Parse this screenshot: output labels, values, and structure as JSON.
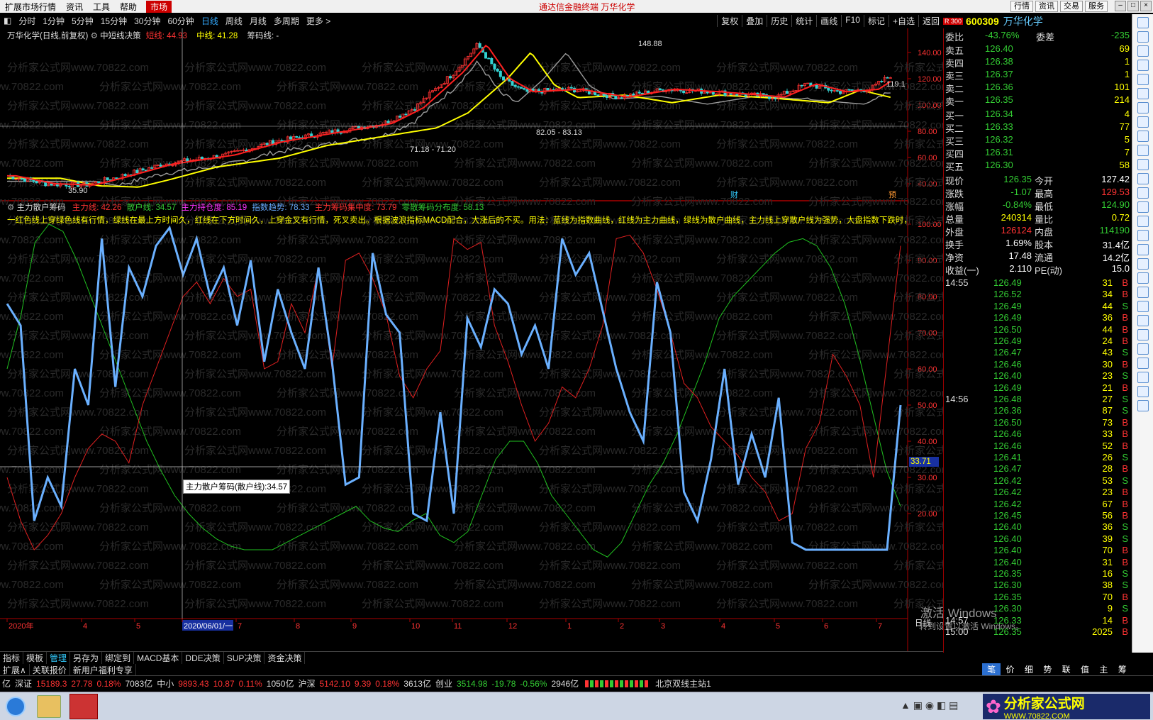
{
  "menu": [
    "扩展市场行情",
    "资讯",
    "工具",
    "帮助"
  ],
  "market_tab": "市场",
  "window_title": "通达信金融终端  万华化学",
  "win_right": [
    "行情",
    "资讯",
    "交易",
    "服务"
  ],
  "periods": [
    "分时",
    "1分钟",
    "5分钟",
    "15分钟",
    "30分钟",
    "60分钟",
    "日线",
    "周线",
    "月线",
    "多周期",
    "更多 >"
  ],
  "active_period": "日线",
  "tool_right": [
    "复权",
    "叠加",
    "历史",
    "统计",
    "画线",
    "F10",
    "标记",
    "+自选",
    "返回"
  ],
  "symbol": {
    "code": "600309",
    "name": "万华化学",
    "badge": "R 300"
  },
  "main_legend": {
    "title": "万华化学(日线,前复权)",
    "ind": "中短线决策",
    "short_label": "短线: 44.93",
    "mid_label": "中线: 41.28",
    "cost_label": "筹码线: -"
  },
  "price_axis": [
    "140.00",
    "120.00",
    "100.00",
    "80.00",
    "60.00",
    "40.00"
  ],
  "price_annot": {
    "high": "148.88",
    "low": "35.90",
    "mid1": "71.18 - 71.20",
    "mid2": "82.05 - 83.13",
    "right": "119.1"
  },
  "event_marks": {
    "cai": "财",
    "duo": "预"
  },
  "sub_legend": {
    "title": "主力散户筹码",
    "a": "主力线: 42.26",
    "b": "散户线: 34.57",
    "c": "主力持仓度: 85.19",
    "d": "指数趋势: 78.33",
    "e": "主力筹码集中度: 73.79",
    "f": "零散筹码分布度: 58.13"
  },
  "scroll_text": "一红色线上穿绿色线有行情，绿线在最上方时间久，红线在下方时间久，上穿金叉有行情，死叉卖出。根据波浪指标MACD配合，大涨后的不买。用法：蓝线为指数曲线，红线为主力曲线，绿线为散户曲线，主力线上穿散户线为强势，大盘指数下跌时，主力线上穿指",
  "sub_axis": [
    "100.00",
    "90.00",
    "80.00",
    "70.00",
    "60.00",
    "50.00",
    "40.00",
    "30.00",
    "20.00"
  ],
  "cross_value": "33.71",
  "tooltip": "主力散户筹码(散户线):34.57",
  "date_axis": [
    {
      "t": "2020年",
      "hl": false
    },
    {
      "t": "4",
      "hl": false
    },
    {
      "t": "5",
      "hl": false
    },
    {
      "t": "2020/06/01/一",
      "hl": true
    },
    {
      "t": "7",
      "hl": false
    },
    {
      "t": "8",
      "hl": false
    },
    {
      "t": "9",
      "hl": false
    },
    {
      "t": "10",
      "hl": false
    },
    {
      "t": "11",
      "hl": false
    },
    {
      "t": "12",
      "hl": false
    },
    {
      "t": "1",
      "hl": false
    },
    {
      "t": "2",
      "hl": false
    },
    {
      "t": "3",
      "hl": false
    },
    {
      "t": "4",
      "hl": false
    },
    {
      "t": "5",
      "hl": false
    },
    {
      "t": "6",
      "hl": false
    },
    {
      "t": "7",
      "hl": false
    }
  ],
  "period_tag": "日线",
  "watermark": "分析家公式网www.70822.com",
  "activate": {
    "l1": "激活 Windows",
    "l2": "转到设置以激活 Windows。"
  },
  "tabs1": [
    "指标",
    "模板",
    "管理",
    "另存为",
    "绑定到",
    "MACD基本",
    "DDE决策",
    "SUP决策",
    "资金决策"
  ],
  "tabs1_active": "管理",
  "tabs2": [
    "扩展∧",
    "关联报价",
    "新用户福利专享"
  ],
  "quote": {
    "weibi": {
      "label": "委比",
      "value": "-43.76%",
      "label2": "委差",
      "value2": "-235"
    },
    "sells": [
      {
        "l": "卖五",
        "p": "126.40",
        "v": "69"
      },
      {
        "l": "卖四",
        "p": "126.38",
        "v": "1"
      },
      {
        "l": "卖三",
        "p": "126.37",
        "v": "1"
      },
      {
        "l": "卖二",
        "p": "126.36",
        "v": "101"
      },
      {
        "l": "卖一",
        "p": "126.35",
        "v": "214"
      }
    ],
    "buys": [
      {
        "l": "买一",
        "p": "126.34",
        "v": "4"
      },
      {
        "l": "买二",
        "p": "126.33",
        "v": "77"
      },
      {
        "l": "买三",
        "p": "126.32",
        "v": "5"
      },
      {
        "l": "买四",
        "p": "126.31",
        "v": "7"
      },
      {
        "l": "买五",
        "p": "126.30",
        "v": "58"
      }
    ],
    "stats": [
      {
        "l": "现价",
        "v": "126.35",
        "l2": "今开",
        "v2": "127.42",
        "c": "#3c3",
        "c2": "#fff"
      },
      {
        "l": "涨跌",
        "v": "-1.07",
        "l2": "最高",
        "v2": "129.53",
        "c": "#3c3",
        "c2": "#f33"
      },
      {
        "l": "涨幅",
        "v": "-0.84%",
        "l2": "最低",
        "v2": "124.90",
        "c": "#3c3",
        "c2": "#3c3"
      },
      {
        "l": "总量",
        "v": "240314",
        "l2": "量比",
        "v2": "0.72",
        "c": "#ff0",
        "c2": "#ff0"
      },
      {
        "l": "外盘",
        "v": "126124",
        "l2": "内盘",
        "v2": "114190",
        "c": "#f33",
        "c2": "#3c3"
      },
      {
        "l": "换手",
        "v": "1.69%",
        "l2": "股本",
        "v2": "31.4亿",
        "c": "#fff",
        "c2": "#fff"
      },
      {
        "l": "净资",
        "v": "17.48",
        "l2": "流通",
        "v2": "14.2亿",
        "c": "#fff",
        "c2": "#fff"
      },
      {
        "l": "收益(一)",
        "v": "2.110",
        "l2": "PE(动)",
        "v2": "15.0",
        "c": "#fff",
        "c2": "#fff"
      }
    ],
    "ticks": [
      {
        "t": "14:55",
        "p": "126.49",
        "v": "31",
        "s": "B"
      },
      {
        "t": "",
        "p": "126.52",
        "v": "34",
        "s": "B"
      },
      {
        "t": "",
        "p": "126.49",
        "v": "44",
        "s": "S"
      },
      {
        "t": "",
        "p": "126.49",
        "v": "36",
        "s": "B"
      },
      {
        "t": "",
        "p": "126.50",
        "v": "44",
        "s": "B"
      },
      {
        "t": "",
        "p": "126.49",
        "v": "24",
        "s": "B"
      },
      {
        "t": "",
        "p": "126.47",
        "v": "43",
        "s": "S"
      },
      {
        "t": "",
        "p": "126.46",
        "v": "30",
        "s": "B"
      },
      {
        "t": "",
        "p": "126.40",
        "v": "23",
        "s": "S"
      },
      {
        "t": "",
        "p": "126.49",
        "v": "21",
        "s": "B"
      },
      {
        "t": "14:56",
        "p": "126.48",
        "v": "27",
        "s": "S"
      },
      {
        "t": "",
        "p": "126.36",
        "v": "87",
        "s": "S"
      },
      {
        "t": "",
        "p": "126.50",
        "v": "73",
        "s": "B"
      },
      {
        "t": "",
        "p": "126.46",
        "v": "33",
        "s": "B"
      },
      {
        "t": "",
        "p": "126.46",
        "v": "52",
        "s": "B"
      },
      {
        "t": "",
        "p": "126.41",
        "v": "26",
        "s": "S"
      },
      {
        "t": "",
        "p": "126.47",
        "v": "28",
        "s": "B"
      },
      {
        "t": "",
        "p": "126.42",
        "v": "53",
        "s": "S"
      },
      {
        "t": "",
        "p": "126.42",
        "v": "23",
        "s": "B"
      },
      {
        "t": "",
        "p": "126.42",
        "v": "67",
        "s": "B"
      },
      {
        "t": "",
        "p": "126.45",
        "v": "56",
        "s": "B"
      },
      {
        "t": "",
        "p": "126.40",
        "v": "36",
        "s": "S"
      },
      {
        "t": "",
        "p": "126.40",
        "v": "39",
        "s": "S"
      },
      {
        "t": "",
        "p": "126.40",
        "v": "70",
        "s": "B"
      },
      {
        "t": "",
        "p": "126.40",
        "v": "31",
        "s": "B"
      },
      {
        "t": "",
        "p": "126.35",
        "v": "16",
        "s": "S"
      },
      {
        "t": "",
        "p": "126.30",
        "v": "38",
        "s": "S"
      },
      {
        "t": "",
        "p": "126.35",
        "v": "70",
        "s": "B"
      },
      {
        "t": "",
        "p": "126.30",
        "v": "9",
        "s": "S"
      },
      {
        "t": "14:57",
        "p": "126.33",
        "v": "14",
        "s": "B"
      },
      {
        "t": "15:00",
        "p": "126.35",
        "v": "2025",
        "s": "B"
      }
    ],
    "tabs": [
      "笔",
      "价",
      "细",
      "势",
      "联",
      "值",
      "主",
      "筹"
    ]
  },
  "indices": [
    {
      "n": "深证",
      "p": "15189.3",
      "c": "27.78",
      "pc": "0.18%",
      "a": "7083亿",
      "col": "#f33"
    },
    {
      "n": "中小",
      "p": "9893.43",
      "c": "10.87",
      "pc": "0.11%",
      "a": "1050亿",
      "col": "#f33"
    },
    {
      "n": "沪深",
      "p": "5142.10",
      "c": "9.39",
      "pc": "0.18%",
      "a": "3613亿",
      "col": "#f33"
    },
    {
      "n": "创业",
      "p": "3514.98",
      "c": "-19.78",
      "pc": "-0.56%",
      "a": "2946亿",
      "col": "#3c3"
    }
  ],
  "idx_prefix": "亿",
  "server": "北京双线主站1",
  "logo_text": "分析家公式网",
  "logo_url": "WWW.70822.COM",
  "colors": {
    "up": "#ff3232",
    "down": "#32c832",
    "blue": "#6ab0ff",
    "yellow": "#ffff00"
  }
}
